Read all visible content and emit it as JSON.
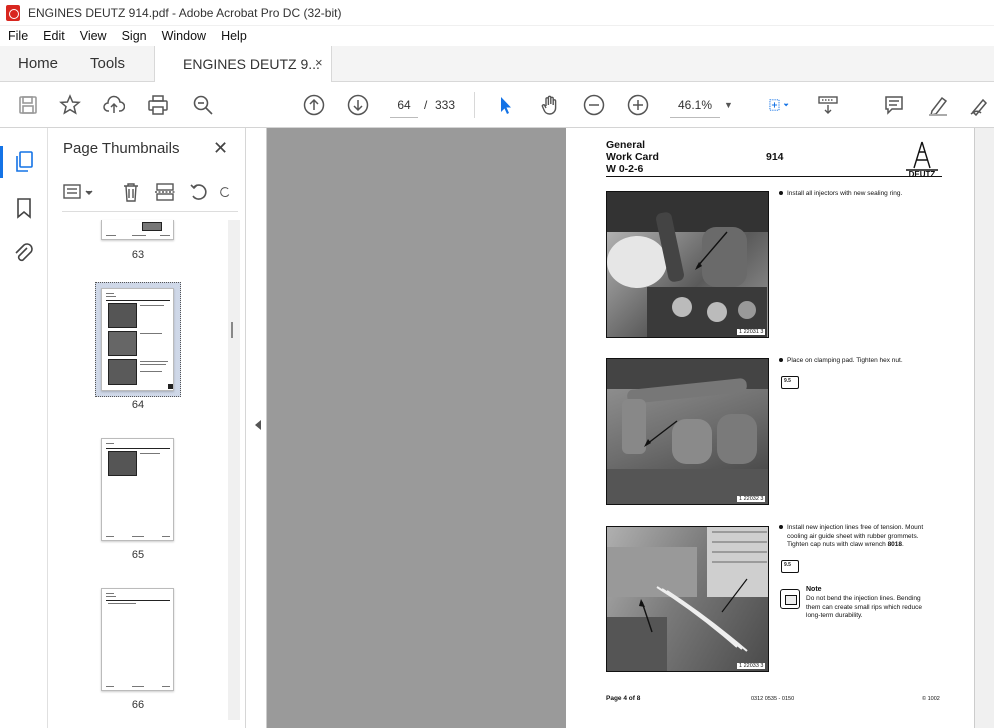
{
  "window": {
    "title": "ENGINES DEUTZ 914.pdf - Adobe Acrobat Pro DC (32-bit)"
  },
  "menu": [
    "File",
    "Edit",
    "View",
    "Sign",
    "Window",
    "Help"
  ],
  "tabs": {
    "home": "Home",
    "tools": "Tools",
    "document": "ENGINES DEUTZ 9...",
    "close": "×"
  },
  "toolbar": {
    "current_page": "64",
    "separator": "/",
    "total_pages": "333",
    "zoom": "46.1%"
  },
  "thumbnails_panel": {
    "title": "Page Thumbnails",
    "close": "✕",
    "pages": [
      {
        "label": "63"
      },
      {
        "label": "64",
        "selected": true
      },
      {
        "label": "65"
      },
      {
        "label": "66"
      }
    ]
  },
  "document_page": {
    "header_left": [
      "General",
      "Work Card",
      "W 0-2-6"
    ],
    "header_number": "914",
    "logo_text": "DEUTZ",
    "steps": [
      {
        "text": "Install all injectors with new sealing ring."
      },
      {
        "text": "Place on clamping pad. Tighten hex nut.",
        "ref": "9.5"
      },
      {
        "text_lines": [
          "Install new injection lines free of tension. Mount",
          "cooling air guide sheet with rubber grommets.",
          "Tighten cap nuts with claw wrench "
        ],
        "tool_no": "8018",
        "tool_suffix": ".",
        "ref": "9.5"
      }
    ],
    "photo_codes": [
      "1 22031 3",
      "1 22032 3",
      "1 22033 3"
    ],
    "note": {
      "title": "Note",
      "lines": [
        "Do not bend the injection lines. Bending",
        "them can create small rips which reduce",
        "long-term durability."
      ]
    },
    "footer": {
      "page": "Page 4 of 8",
      "code": "0312 0535 - 0150",
      "date": "© 1002"
    }
  },
  "colors": {
    "accent": "#1473e6",
    "doc_background": "#9a9a9a"
  }
}
